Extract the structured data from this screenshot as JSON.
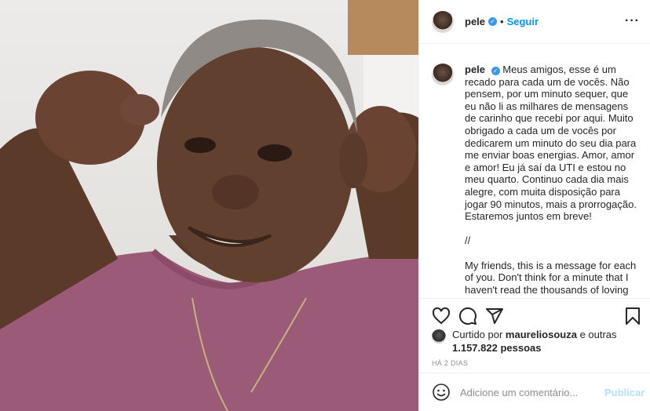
{
  "post": {
    "username": "pele",
    "verified_mark": "✓",
    "separator": "•",
    "follow_label": "Seguir",
    "more_label": "···"
  },
  "caption": {
    "username": "pele",
    "paragraphs": [
      "Meus amigos, esse é um recado para cada um de vocês. Não pensem, por um minuto sequer, que eu não li as milhares de mensagens de carinho que recebi por aqui. Muito obrigado a cada um de vocês por dedicarem um minuto do seu dia para me enviar boas energias. Amor, amor e amor! Eu já saí da UTI e estou no meu quarto. Continuo cada dia mais alegre, com muita disposição para jogar 90 minutos, mais a prorrogação. Estaremos juntos em breve!",
      "//",
      "My friends, this is a message for each of you. Don't think for a minute that I haven't read the thousands of loving"
    ]
  },
  "actions": {
    "icons": [
      "heart-icon",
      "comment-icon",
      "share-icon",
      "bookmark-icon"
    ]
  },
  "likes": {
    "prefix": "Curtido por ",
    "user": "maureliosouza",
    "middle": " e outras ",
    "count": "1.157.822",
    "suffix": " pessoas"
  },
  "date": "HÁ 2 DIAS",
  "comment_box": {
    "placeholder": "Adicione um comentário...",
    "publish_label": "Publicar"
  },
  "colors": {
    "accent": "#0095f6",
    "verified": "#3897f0",
    "publish_disabled": "#b2dffc",
    "muted": "#8e8e8e",
    "shirt": "#9a5a78"
  }
}
